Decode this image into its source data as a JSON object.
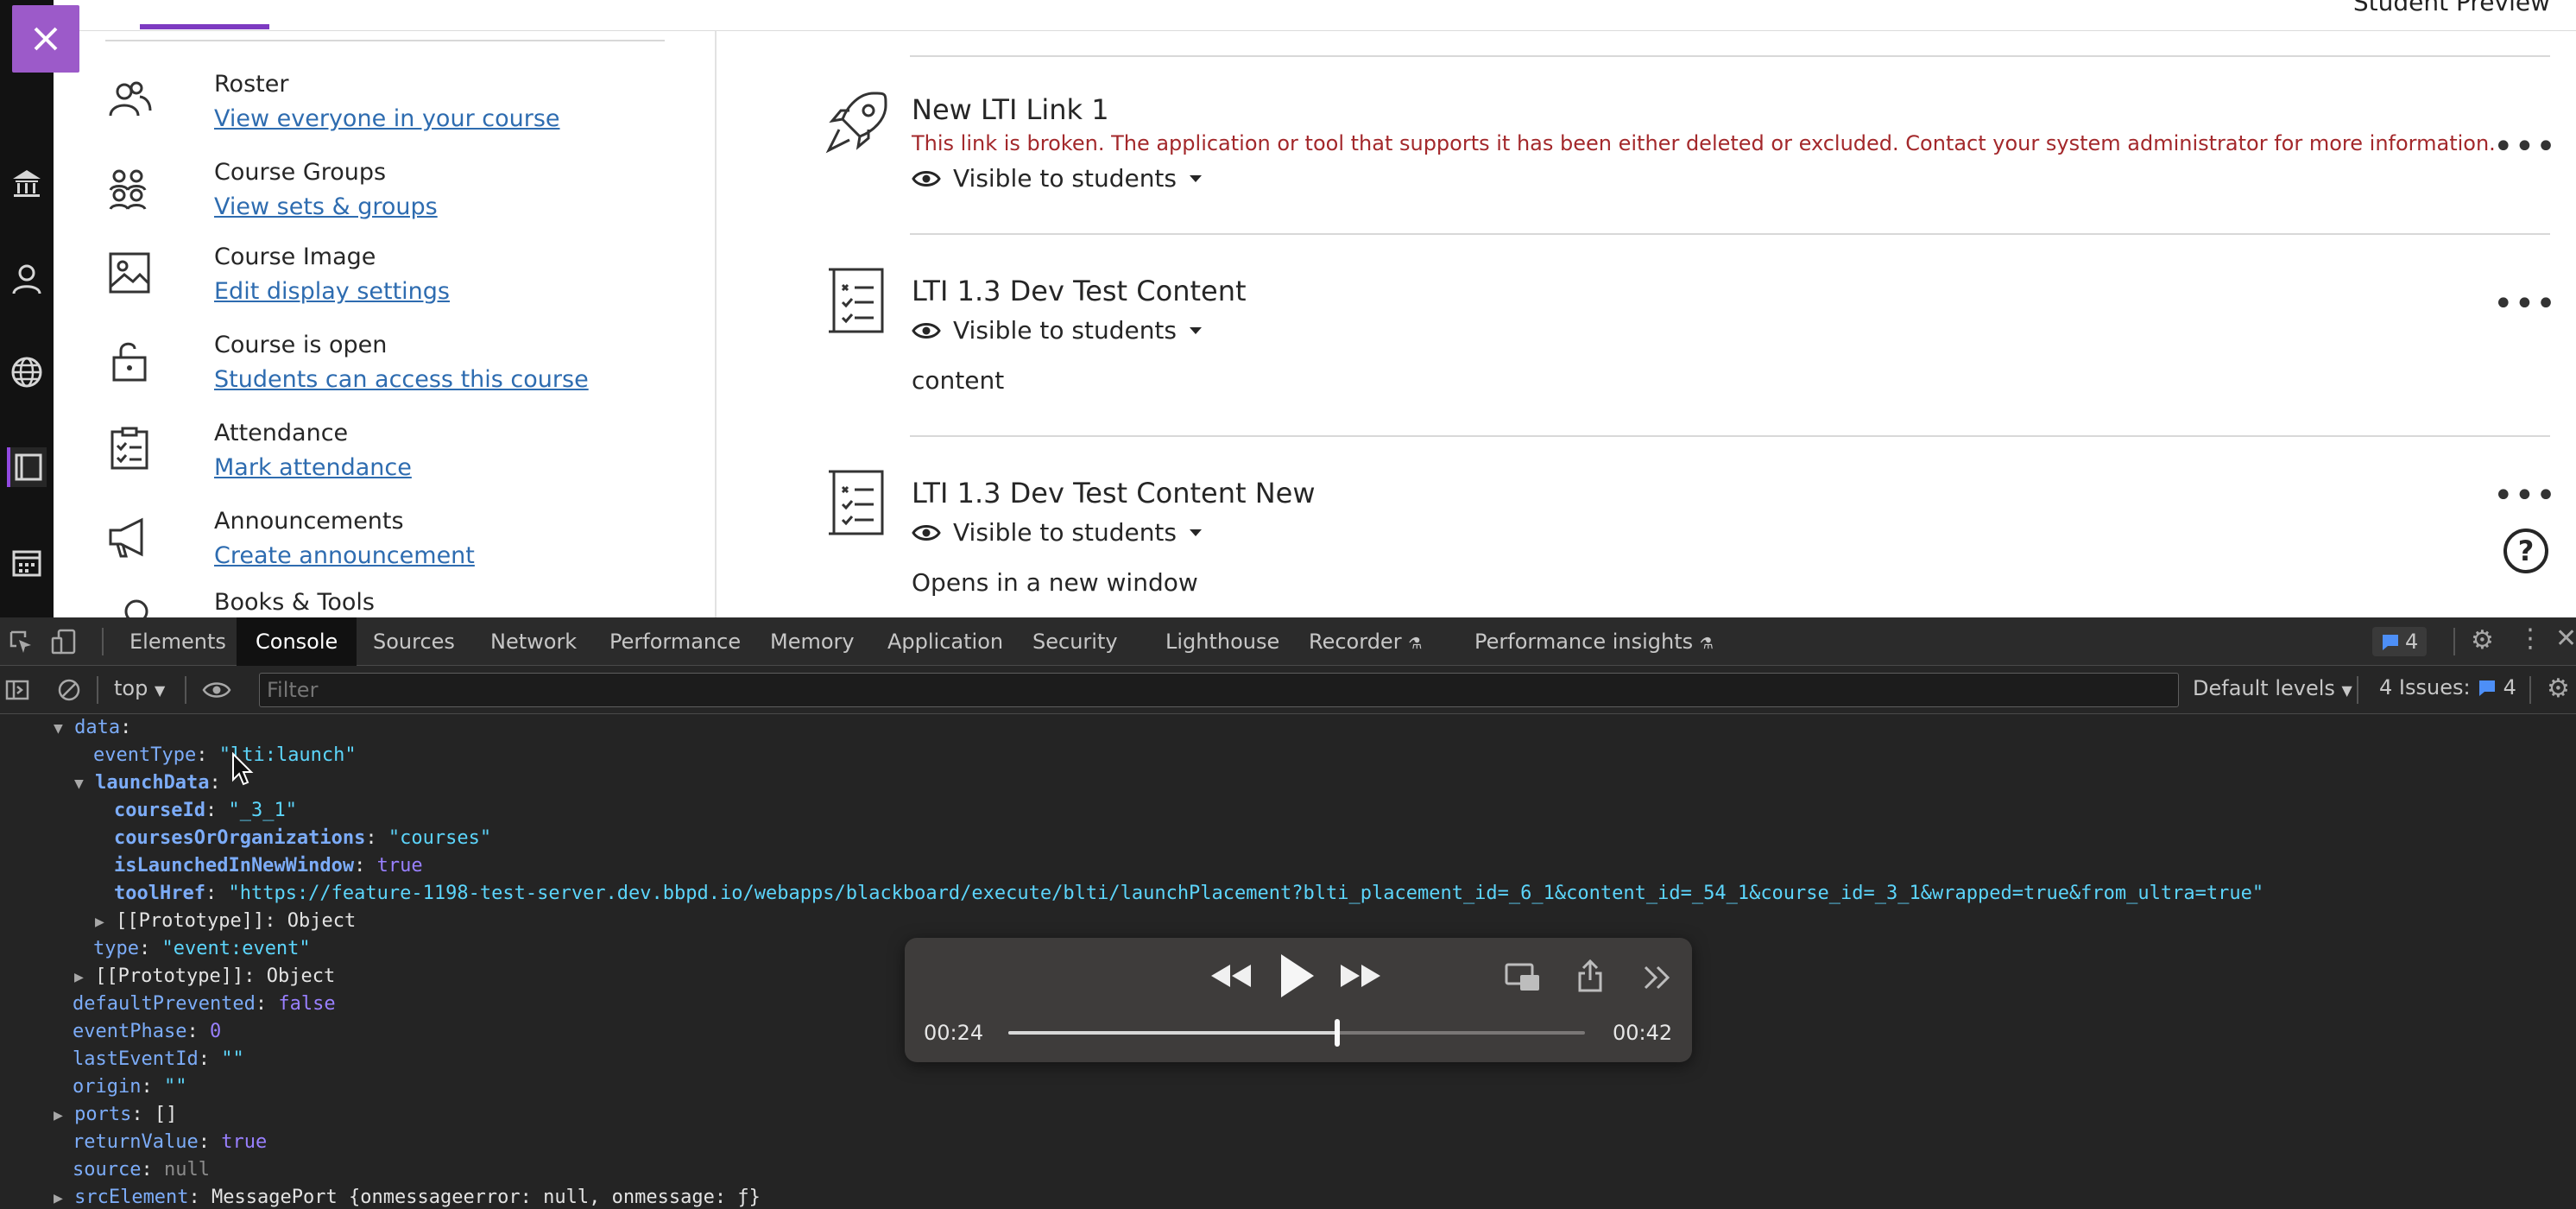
{
  "topbar": {
    "fragment": "Student Preview"
  },
  "sidebar_tools": [
    {
      "title": "Roster",
      "link": "View everyone in your course"
    },
    {
      "title": "Course Groups",
      "link": "View sets & groups"
    },
    {
      "title": "Course Image",
      "link": "Edit display settings"
    },
    {
      "title": "Course is open",
      "link": "Students can access this course"
    },
    {
      "title": "Attendance",
      "link": "Mark attendance"
    },
    {
      "title": "Announcements",
      "link": "Create announcement"
    },
    {
      "title": "Books & Tools",
      "link": ""
    }
  ],
  "content_items": [
    {
      "title": "New LTI Link 1",
      "error": "This link is broken. The application or tool that supports it has been either deleted or excluded. Contact your system administrator for more information.",
      "visibility": "Visible to students",
      "description": ""
    },
    {
      "title": "LTI 1.3 Dev Test Content",
      "error": "",
      "visibility": "Visible to students",
      "description": "content"
    },
    {
      "title": "LTI 1.3 Dev Test Content New",
      "error": "",
      "visibility": "Visible to students",
      "description": "Opens in a new window"
    }
  ],
  "devtools": {
    "tabs": [
      "Elements",
      "Console",
      "Sources",
      "Network",
      "Performance",
      "Memory",
      "Application",
      "Security",
      "Lighthouse",
      "Recorder",
      "Performance insights"
    ],
    "message_count": "4",
    "context": "top",
    "filter_placeholder": "Filter",
    "levels": "Default levels",
    "issues_label": "4 Issues:",
    "issues_count": "4"
  },
  "console_lines": {
    "l1k": "data",
    "l2k": "eventType",
    "l2v": "\"lti:launch\"",
    "l3k": "launchData",
    "l4k": "courseId",
    "l4v": "\"_3_1\"",
    "l5k": "coursesOrOrganizations",
    "l5v": "\"courses\"",
    "l6k": "isLaunchedInNewWindow",
    "l6v": "true",
    "l7k": "toolHref",
    "l7v": "\"https://feature-1198-test-server.dev.bbpd.io/webapps/blackboard/execute/blti/launchPlacement?blti_placement_id=_6_1&content_id=_54_1&course_id=_3_1&wrapped=true&from_ultra=true\"",
    "l8k": "[[Prototype]]",
    "l8v": "Object",
    "l9k": "type",
    "l9v": "\"event:event\"",
    "l10k": "[[Prototype]]",
    "l10v": "Object",
    "l11k": "defaultPrevented",
    "l11v": "false",
    "l12k": "eventPhase",
    "l12v": "0",
    "l13k": "lastEventId",
    "l13v": "\"\"",
    "l14k": "origin",
    "l14v": "\"\"",
    "l15k": "ports",
    "l15v": "[]",
    "l16k": "returnValue",
    "l16v": "true",
    "l17k": "source",
    "l17v": "null",
    "l18k": "srcElement",
    "l18v": "MessagePort {onmessageerror: null, onmessage: ƒ}"
  },
  "media": {
    "elapsed": "00:24",
    "remaining": "00:42",
    "progress": 0.57
  }
}
